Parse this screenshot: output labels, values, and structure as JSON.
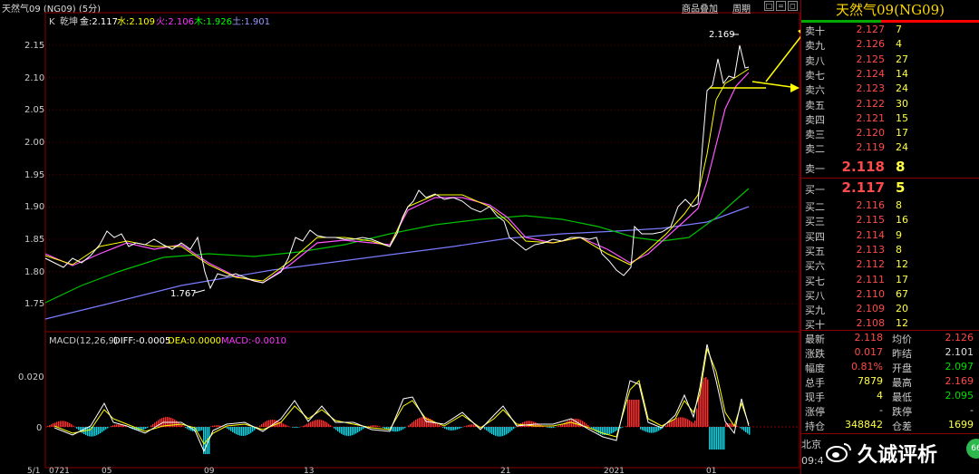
{
  "window": {
    "title": "天然气09 (NG09) (5分)",
    "links": [
      "商品叠加",
      "周期"
    ],
    "ctrl_glyphs": [
      "□",
      "=",
      "◻",
      "□"
    ]
  },
  "price_chart": {
    "legend": {
      "prefix": "K",
      "name": "乾坤",
      "items": [
        {
          "label": "金:2.117",
          "color": "#ffffff"
        },
        {
          "label": "水:2.109",
          "color": "#ffff00"
        },
        {
          "label": "火:2.106",
          "color": "#ff33ff"
        },
        {
          "label": "木:1.926",
          "color": "#00ff00"
        },
        {
          "label": "土:1.901",
          "color": "#9999ff"
        }
      ]
    },
    "y_ticks": [
      "2.15",
      "2.10",
      "2.05",
      "2.00",
      "1.95",
      "1.90",
      "1.85",
      "1.80",
      "1.75"
    ],
    "y_values": [
      2.15,
      2.1,
      2.05,
      2.0,
      1.95,
      1.9,
      1.85,
      1.8,
      1.75
    ],
    "high_marker": "2.169",
    "low_marker": "1.767"
  },
  "macd_chart": {
    "legend": [
      {
        "label": "MACD(12,26,9)",
        "color": "#cccccc"
      },
      {
        "label": "DIFF:-0.0005",
        "color": "#ffffff"
      },
      {
        "label": "DEA:0.0000",
        "color": "#ffff00"
      },
      {
        "label": "MACD:-0.0010",
        "color": "#ff33ff"
      }
    ],
    "y_ticks": [
      "0.020",
      "0"
    ]
  },
  "x_axis": {
    "labels": [
      "5/1",
      "0721",
      "05",
      "09",
      "13",
      "21",
      "2021",
      "01"
    ]
  },
  "panel": {
    "title": "天然气09(NG09)",
    "asks": [
      {
        "label": "卖十",
        "price": "2.127",
        "vol": "7"
      },
      {
        "label": "卖九",
        "price": "2.126",
        "vol": "4"
      },
      {
        "label": "卖八",
        "price": "2.125",
        "vol": "27"
      },
      {
        "label": "卖七",
        "price": "2.124",
        "vol": "14"
      },
      {
        "label": "卖六",
        "price": "2.123",
        "vol": "24"
      },
      {
        "label": "卖五",
        "price": "2.122",
        "vol": "30"
      },
      {
        "label": "卖四",
        "price": "2.121",
        "vol": "15"
      },
      {
        "label": "卖三",
        "price": "2.120",
        "vol": "17"
      },
      {
        "label": "卖二",
        "price": "2.119",
        "vol": "24"
      },
      {
        "label": "卖一",
        "price": "2.118",
        "vol": "8"
      }
    ],
    "bids": [
      {
        "label": "买一",
        "price": "2.117",
        "vol": "5"
      },
      {
        "label": "买二",
        "price": "2.116",
        "vol": "8"
      },
      {
        "label": "买三",
        "price": "2.115",
        "vol": "16"
      },
      {
        "label": "买四",
        "price": "2.114",
        "vol": "9"
      },
      {
        "label": "买五",
        "price": "2.113",
        "vol": "8"
      },
      {
        "label": "买六",
        "price": "2.112",
        "vol": "12"
      },
      {
        "label": "买七",
        "price": "2.111",
        "vol": "17"
      },
      {
        "label": "买八",
        "price": "2.110",
        "vol": "67"
      },
      {
        "label": "买九",
        "price": "2.109",
        "vol": "20"
      },
      {
        "label": "买十",
        "price": "2.108",
        "vol": "12"
      }
    ],
    "stats": [
      {
        "l1": "最新",
        "v1": "2.118",
        "c1": "red",
        "l2": "均价",
        "v2": "2.126",
        "c2": "red"
      },
      {
        "l1": "涨跌",
        "v1": "0.017",
        "c1": "red",
        "l2": "昨结",
        "v2": "2.101",
        "c2": "wht"
      },
      {
        "l1": "幅度",
        "v1": "0.81%",
        "c1": "red",
        "l2": "开盘",
        "v2": "2.097",
        "c2": "grn"
      },
      {
        "l1": "总手",
        "v1": "7879",
        "c1": "yel",
        "l2": "最高",
        "v2": "2.169",
        "c2": "red"
      },
      {
        "l1": "现手",
        "v1": "4",
        "c1": "yel",
        "l2": "最低",
        "v2": "2.095",
        "c2": "grn"
      },
      {
        "l1": "涨停",
        "v1": "-",
        "c1": "wht",
        "l2": "跌停",
        "v2": "-",
        "c2": "wht"
      },
      {
        "l1": "持仓",
        "v1": "348842",
        "c1": "yel",
        "l2": "仓差",
        "v2": "1699",
        "c2": "yel"
      }
    ],
    "footer_city": "北京",
    "footer_time": "09:4"
  },
  "watermark": {
    "text": "久诚评析",
    "badge": "66"
  }
}
